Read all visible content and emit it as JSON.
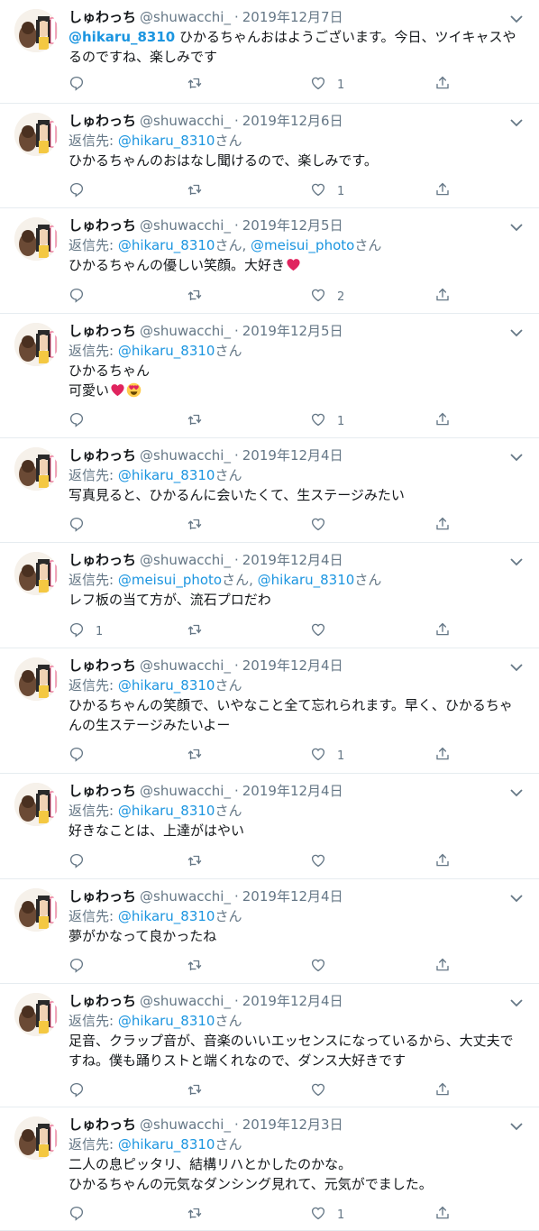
{
  "author": {
    "name": "しゅわっち",
    "handle": "@shuwacchi_",
    "dot": "·"
  },
  "reply_prefix": "返信先:",
  "san": "さん",
  "comma": ", ",
  "tweets": [
    {
      "date": "2019年12月7日",
      "mention_lead": "@hikaru_8310",
      "text": " ひかるちゃんおはようございます。今日、ツイキャスやるのですね、楽しみです",
      "replies": "",
      "retweets": "",
      "likes": "1"
    },
    {
      "date": "2019年12月6日",
      "reply_to": [
        "@hikaru_8310"
      ],
      "text": "ひかるちゃんのおはなし聞けるので、楽しみです。",
      "replies": "",
      "retweets": "",
      "likes": "1"
    },
    {
      "date": "2019年12月5日",
      "reply_to": [
        "@hikaru_8310",
        "@meisui_photo"
      ],
      "text": "ひかるちゃんの優しい笑顔。大好き",
      "emoji": "heart",
      "replies": "",
      "retweets": "",
      "likes": "2"
    },
    {
      "date": "2019年12月5日",
      "reply_to": [
        "@hikaru_8310"
      ],
      "text": "ひかるちゃん",
      "text2": "可愛い",
      "emoji2": "heart-eyes",
      "replies": "",
      "retweets": "",
      "likes": "1"
    },
    {
      "date": "2019年12月4日",
      "reply_to": [
        "@hikaru_8310"
      ],
      "text": "写真見ると、ひかるんに会いたくて、生ステージみたい",
      "replies": "",
      "retweets": "",
      "likes": ""
    },
    {
      "date": "2019年12月4日",
      "reply_to": [
        "@meisui_photo",
        "@hikaru_8310"
      ],
      "text": "レフ板の当て方が、流石プロだわ",
      "replies": "1",
      "retweets": "",
      "likes": ""
    },
    {
      "date": "2019年12月4日",
      "reply_to": [
        "@hikaru_8310"
      ],
      "text": "ひかるちゃんの笑顔で、いやなこと全て忘れられます。早く、ひかるちゃんの生ステージみたいよー",
      "replies": "",
      "retweets": "",
      "likes": "1"
    },
    {
      "date": "2019年12月4日",
      "reply_to": [
        "@hikaru_8310"
      ],
      "text": "好きなことは、上達がはやい",
      "replies": "",
      "retweets": "",
      "likes": ""
    },
    {
      "date": "2019年12月4日",
      "reply_to": [
        "@hikaru_8310"
      ],
      "text": "夢がかなって良かったね",
      "replies": "",
      "retweets": "",
      "likes": ""
    },
    {
      "date": "2019年12月4日",
      "reply_to": [
        "@hikaru_8310"
      ],
      "text": "足音、クラップ音が、音楽のいいエッセンスになっているから、大丈夫ですね。僕も踊りストと端くれなので、ダンス大好きです",
      "replies": "",
      "retweets": "",
      "likes": ""
    },
    {
      "date": "2019年12月3日",
      "reply_to": [
        "@hikaru_8310"
      ],
      "text": "二人の息ピッタリ、結構リハとかしたのかな。",
      "text2": "ひかるちゃんの元気なダンシング見れて、元気がでました。",
      "replies": "",
      "retweets": "",
      "likes": "1"
    }
  ],
  "icons": {
    "reply": "reply-icon",
    "retweet": "retweet-icon",
    "like": "heart-icon",
    "share": "share-icon",
    "caret": "chevron-down-icon"
  },
  "colors": {
    "link": "#1b95e0",
    "muted": "#657786",
    "text": "#14171a",
    "divider": "#e6ecf0",
    "heart": "#e0245e"
  }
}
